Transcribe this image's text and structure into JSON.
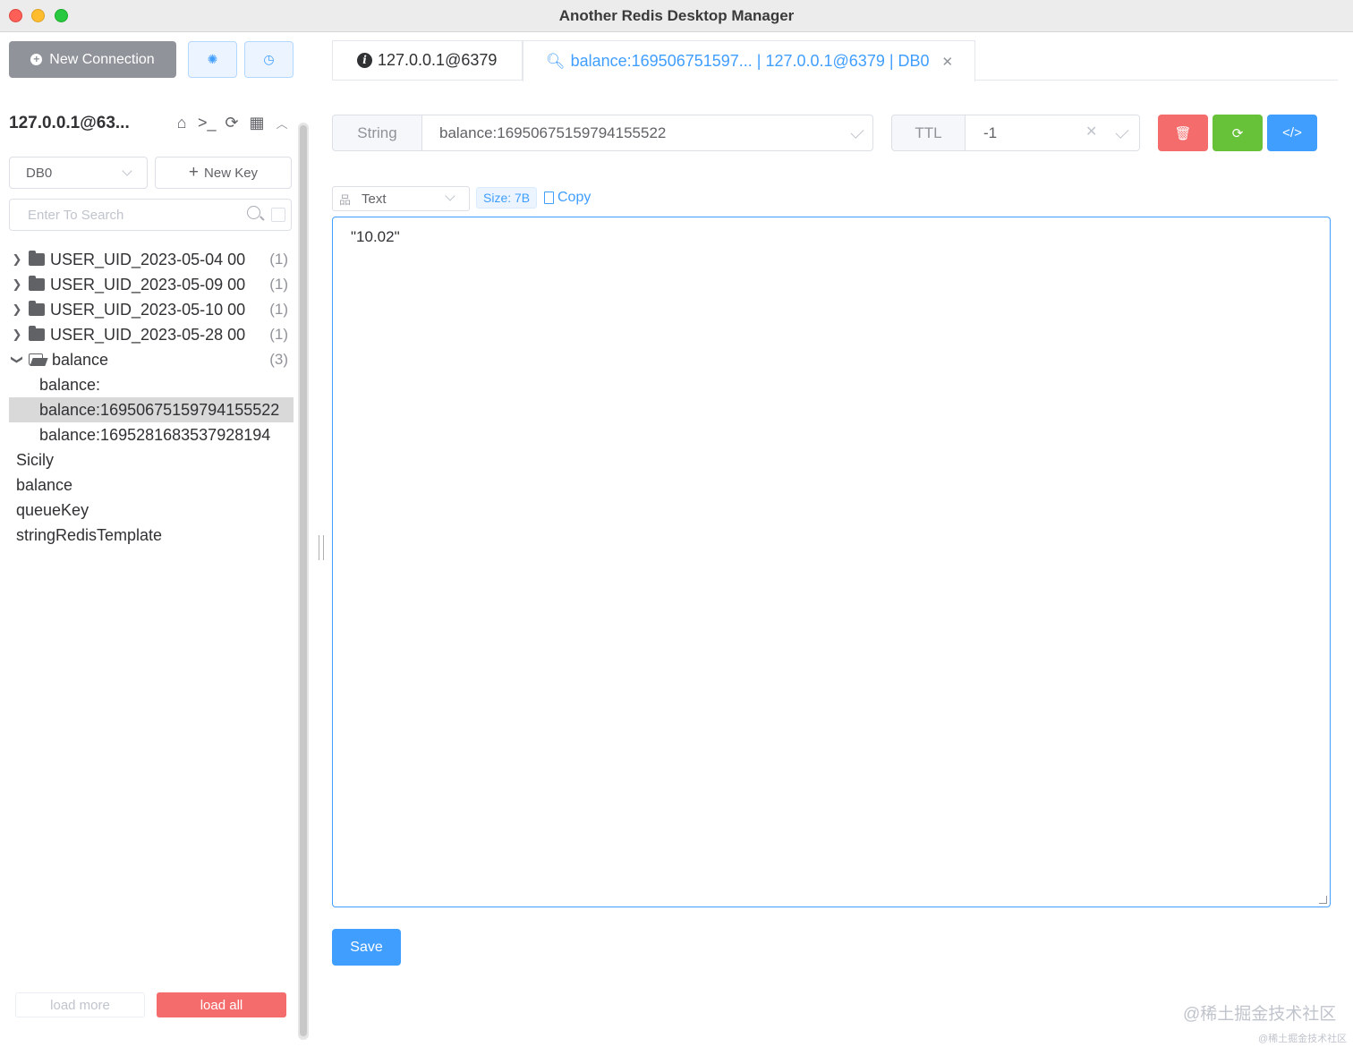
{
  "window": {
    "title": "Another Redis Desktop Manager"
  },
  "sidebar": {
    "new_connection_label": "New Connection",
    "connection_title": "127.0.0.1@63...",
    "db_selected": "DB0",
    "new_key_label": "New Key",
    "search_placeholder": "Enter To Search",
    "tree": {
      "folders": [
        {
          "label": "USER_UID_2023-05-04 00",
          "count": "(1)"
        },
        {
          "label": "USER_UID_2023-05-09 00",
          "count": "(1)"
        },
        {
          "label": "USER_UID_2023-05-10 00",
          "count": "(1)"
        },
        {
          "label": "USER_UID_2023-05-28 00",
          "count": "(1)"
        }
      ],
      "open_folder": {
        "label": "balance",
        "count": "(3)"
      },
      "children": [
        "balance:",
        "balance:1695067515979415​5522",
        "balance:1695281683537928194"
      ],
      "top_keys": [
        "Sicily",
        "balance",
        "queueKey",
        "stringRedisTemplate"
      ]
    },
    "load_more_label": "load more",
    "load_all_label": "load all"
  },
  "tabs": {
    "info_tab": "127.0.0.1@6379",
    "key_tab": "balance:169506751597... | 127.0.0.1@6379 | DB0"
  },
  "key_detail": {
    "type": "String",
    "key_name": "balance:16950675159794155522",
    "ttl_label": "TTL",
    "ttl_value": "-1",
    "format": "Text",
    "size": "Size: 7B",
    "copy_label": "Copy",
    "value": "\"10.02\"",
    "save_label": "Save"
  },
  "watermark": "@稀土掘金技术社区",
  "icons": [
    "plus-circle-icon",
    "settings-icon",
    "history-icon",
    "home-icon",
    "terminal-icon",
    "refresh-icon",
    "grid-icon",
    "collapse-icon",
    "search-icon",
    "folder-icon",
    "folder-open-icon",
    "info-icon",
    "key-icon",
    "close-icon",
    "check-icon",
    "delete-icon",
    "code-icon",
    "tree-icon",
    "document-icon"
  ],
  "colors": {
    "primary": "#409eff",
    "danger": "#f56c6c",
    "success": "#67c23a",
    "neutral": "#909399"
  }
}
